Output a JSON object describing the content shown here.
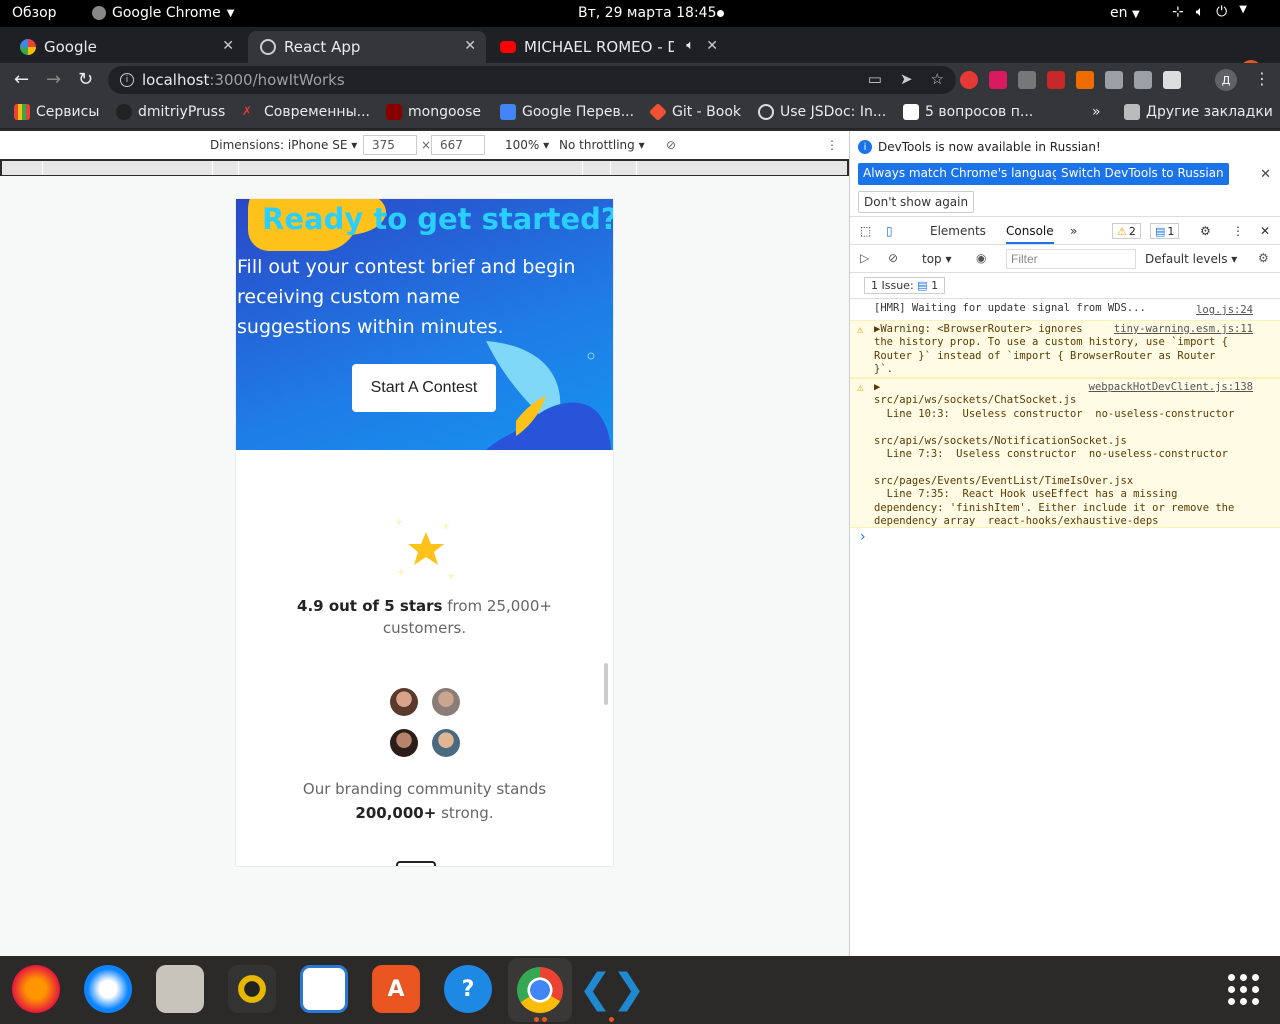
{
  "topbar": {
    "activities": "Обзор",
    "app_name": "Google Chrome",
    "datetime": "Вт, 29 марта  18:45",
    "lang": "en"
  },
  "tabs": [
    {
      "label": "Google"
    },
    {
      "label": "React App"
    },
    {
      "label": "MICHAEL ROMEO - Div"
    }
  ],
  "address": {
    "host": "localhost",
    "path": ":3000/howItWorks"
  },
  "bookmarks": [
    {
      "label": "Сервисы"
    },
    {
      "label": "dmitriyPruss"
    },
    {
      "label": "Современны..."
    },
    {
      "label": "mongoose"
    },
    {
      "label": "Google Перев..."
    },
    {
      "label": "Git - Book"
    },
    {
      "label": "Use JSDoc: In..."
    },
    {
      "label": "5 вопросов п..."
    },
    {
      "label": "Другие закладки"
    }
  ],
  "device_toolbar": {
    "dimensions": "Dimensions: iPhone SE",
    "width": "375",
    "height": "667",
    "zoom": "100%",
    "throttling": "No throttling"
  },
  "page": {
    "hero_title": "Ready to get started?",
    "hero_text": "Fill out your contest brief and begin receiving custom name suggestions within minutes.",
    "cta_label": "Start A Contest",
    "rating_bold": "4.9 out of 5 stars",
    "rating_rest": " from 25,000+",
    "rating_line2": "customers.",
    "community_text": "Our branding community stands",
    "community_bold": "200,000+",
    "community_rest": " strong."
  },
  "devtools": {
    "info_message": "DevTools is now available in Russian!",
    "btn_match": "Always match Chrome's language",
    "btn_switch": "Switch DevTools to Russian",
    "btn_dont_show": "Don't show again",
    "tab_elements": "Elements",
    "tab_console": "Console",
    "warn_count": "2",
    "msg_count": "1",
    "context": "top",
    "filter_placeholder": "Filter",
    "levels": "Default levels",
    "issues": "1 Issue:",
    "issues_count": "1",
    "logs": [
      {
        "text": "[HMR] Waiting for update signal from WDS...",
        "src": "log.js:24"
      },
      {
        "text": "▶Warning: <BrowserRouter> ignores\nthe history prop. To use a custom history, use `import {\nRouter }` instead of `import { BrowserRouter as Router\n}`.",
        "src": "tiny-warning.esm.js:11"
      },
      {
        "text": "▶\nsrc/api/ws/sockets/ChatSocket.js\n  Line 10:3:  Useless constructor  no-useless-constructor\n\nsrc/api/ws/sockets/NotificationSocket.js\n  Line 7:3:  Useless constructor  no-useless-constructor\n\nsrc/pages/Events/EventList/TimeIsOver.jsx\n  Line 7:35:  React Hook useEffect has a missing\ndependency: 'finishItem'. Either include it or remove the\ndependency array  react-hooks/exhaustive-deps",
        "src": "webpackHotDevClient.js:138"
      }
    ]
  },
  "colors": {
    "hero_title": "#29d0ff",
    "hero_bg": "#1f7ce6",
    "star": "#ffc21a",
    "devtools_blue": "#1a73e8",
    "ubuntu_orange": "#e95420"
  }
}
